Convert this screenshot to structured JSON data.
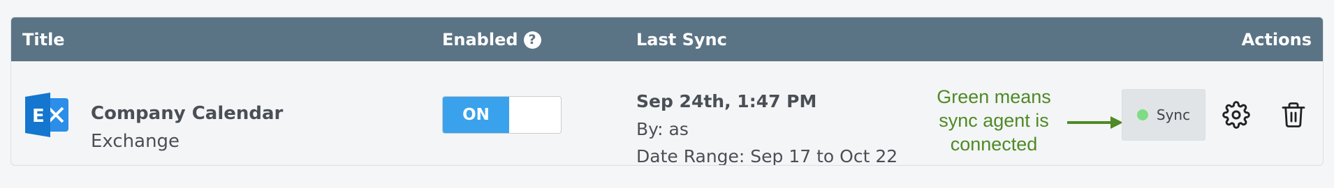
{
  "header": {
    "title_col": "Title",
    "enabled_col": "Enabled",
    "last_sync_col": "Last Sync",
    "actions_col": "Actions"
  },
  "row": {
    "icon": "exchange-icon",
    "title": "Company Calendar",
    "subtitle": "Exchange",
    "toggle_label": "ON",
    "enabled": true,
    "last_sync": {
      "date": "Sep 24th, 1:47 PM",
      "by": "By: as",
      "range": "Date Range: Sep 17 to Oct 22"
    },
    "annotation": [
      "Green means",
      "sync agent is",
      "connected"
    ],
    "sync_button": "Sync",
    "status_color": "#7fdc84"
  },
  "colors": {
    "header_bg": "#5b7485",
    "toggle_on": "#3aa2ec",
    "annotation_text": "#4e8a25",
    "exchange_blue": "#1476cf"
  }
}
